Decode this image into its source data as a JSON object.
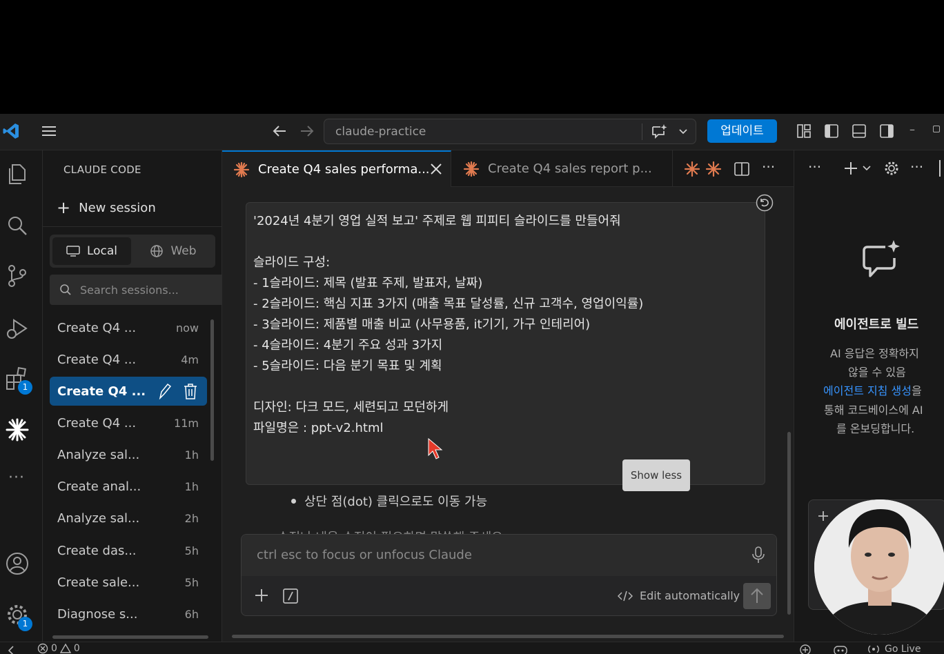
{
  "app": {
    "window_title": "claude-practice",
    "update_button": "업데이트",
    "accent_color": "#0078d4"
  },
  "activity_bar": {
    "icons": [
      "files-icon",
      "search-icon",
      "source-control-icon",
      "run-debug-icon",
      "extensions-icon",
      "claude-icon",
      "more-icon",
      "account-icon",
      "settings-gear-icon"
    ],
    "extensions_badge": "1",
    "settings_badge": "1"
  },
  "sidebar": {
    "title": "CLAUDE CODE",
    "new_session": "New session",
    "tabs": {
      "local": "Local",
      "web": "Web"
    },
    "search_placeholder": "Search sessions...",
    "sessions": [
      {
        "name": "Create Q4 ...",
        "time": "now"
      },
      {
        "name": "Create Q4 ...",
        "time": "4m"
      },
      {
        "name": "Create Q4 ...",
        "time": ""
      },
      {
        "name": "Create Q4 ...",
        "time": "11m"
      },
      {
        "name": "Analyze sal...",
        "time": "1h"
      },
      {
        "name": "Create anal...",
        "time": "1h"
      },
      {
        "name": "Analyze sal...",
        "time": "2h"
      },
      {
        "name": "Create das...",
        "time": "5h"
      },
      {
        "name": "Create sale...",
        "time": "5h"
      },
      {
        "name": "Diagnose s...",
        "time": "6h"
      }
    ]
  },
  "editor": {
    "tabs": [
      {
        "label": "Create Q4 sales performa..."
      },
      {
        "label": "Create Q4 sales report p..."
      }
    ],
    "message_lines": [
      "'2024년 4분기 영업 실적 보고' 주제로 웹 피피티 슬라이드를 만들어줘",
      "",
      "슬라이드 구성:",
      "- 1슬라이드: 제목 (발표 주제, 발표자, 날짜)",
      "- 2슬라이드: 핵심 지표 3가지 (매출 목표 달성률, 신규 고객수, 영업이익률)",
      "- 3슬라이드: 제품별 매출 비교 (사무용품, it기기, 가구 인테리어)",
      "- 4슬라이드: 4분기 주요 성과 3가지",
      "- 5슬라이드: 다음 분기 목표 및 계획",
      "",
      "디자인: 다크 모드, 세련되고 모던하게",
      "파일명은 : ppt-v2.html"
    ],
    "show_less": "Show less",
    "bullet_text": "상단 점(dot) 클릭으로도 이동 가능",
    "partial_text": "수정나 내용 수정이 필요하면 말씀해 주세요",
    "input_placeholder": "ctrl esc to focus or unfocus Claude",
    "edit_mode": "Edit automatically"
  },
  "right_panel": {
    "heading": "에이전트로 빌드",
    "text_lines": [
      "AI 응답은 정확하지",
      "않을 수 있음"
    ],
    "link_text": "에이전트 지침 생성",
    "link_suffix": "을",
    "text_lines_2": [
      "통해 코드베이스에 AI",
      "를 온보딩합니다."
    ]
  },
  "status_bar": {
    "errors": "0",
    "warnings": "0",
    "go_live": "Go Live"
  }
}
